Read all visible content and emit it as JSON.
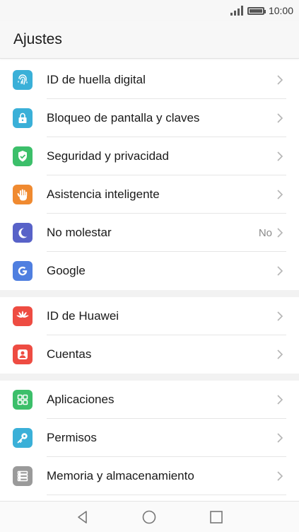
{
  "status_bar": {
    "time": "10:00"
  },
  "header": {
    "title": "Ajustes"
  },
  "groups": [
    {
      "items": [
        {
          "label": "ID de huella digital",
          "icon": "fingerprint-icon",
          "color": "#3ab0d8"
        },
        {
          "label": "Bloqueo de pantalla y claves",
          "icon": "lock-icon",
          "color": "#3ab0d8"
        },
        {
          "label": "Seguridad y privacidad",
          "icon": "shield-icon",
          "color": "#3cbf6a"
        },
        {
          "label": "Asistencia inteligente",
          "icon": "hand-icon",
          "color": "#f08a30"
        },
        {
          "label": "No molestar",
          "value": "No",
          "icon": "moon-icon",
          "color": "#5862c8"
        },
        {
          "label": "Google",
          "icon": "google-icon",
          "color": "#4f7fe0"
        }
      ]
    },
    {
      "items": [
        {
          "label": "ID de Huawei",
          "icon": "huawei-icon",
          "color": "#ee4c42"
        },
        {
          "label": "Cuentas",
          "icon": "user-icon",
          "color": "#ee4c42"
        }
      ]
    },
    {
      "items": [
        {
          "label": "Aplicaciones",
          "icon": "apps-grid-icon",
          "color": "#3cbf6a"
        },
        {
          "label": "Permisos",
          "icon": "key-icon",
          "color": "#3ab0d8"
        },
        {
          "label": "Memoria y almacenamiento",
          "icon": "storage-icon",
          "color": "#9a9a9a"
        }
      ]
    }
  ],
  "nav_bar": {
    "buttons": [
      "back-icon",
      "home-icon",
      "recents-icon"
    ]
  }
}
